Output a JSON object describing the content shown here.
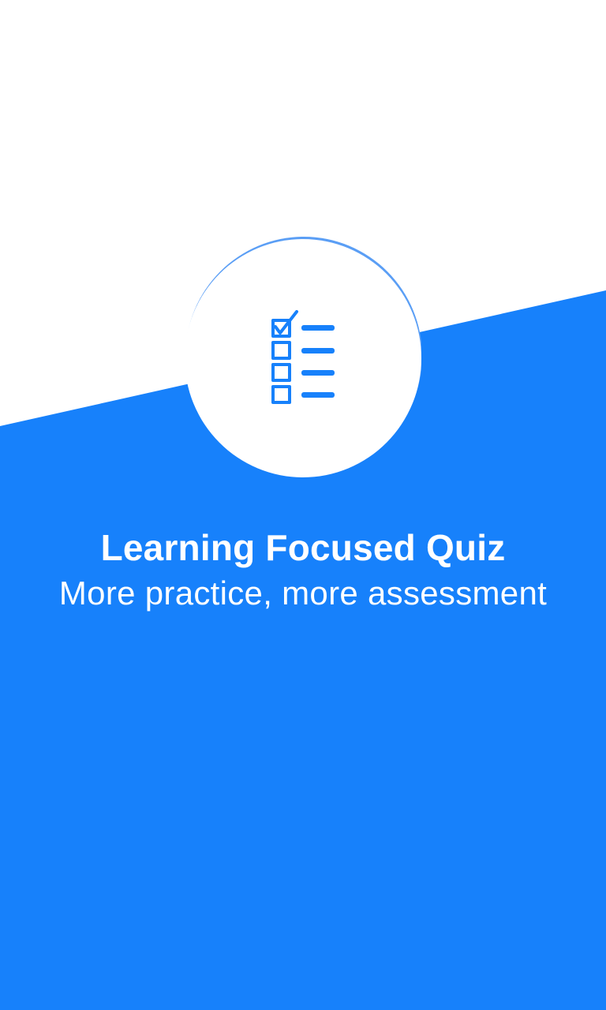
{
  "onboarding": {
    "title": "Learning Focused Quiz",
    "subtitle": "More practice, more assessment",
    "icon": "checklist-icon"
  },
  "colors": {
    "brand_blue": "#1781fb",
    "light_blue_accent": "#5a9ef5",
    "white": "#ffffff"
  }
}
